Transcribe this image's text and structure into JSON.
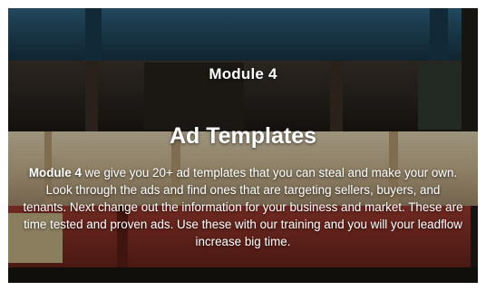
{
  "card": {
    "module_label": "Module 4",
    "title": "Ad Templates",
    "description_lead": "Module 4",
    "description_body": " we give you 20+ ad templates that you can steal and make your own. Look through the ads and find ones that are targeting sellers, buyers, and tenants. Next change out the information for your business and market. These are time tested and proven ads. Use these with our training and you will your leadflow increase big time."
  },
  "colors": {
    "text": "#ffffff",
    "book_blue": "#1f4a63",
    "book_dark": "#2a2420",
    "book_cream": "#d9c9a8",
    "book_red": "#8c2d25"
  }
}
